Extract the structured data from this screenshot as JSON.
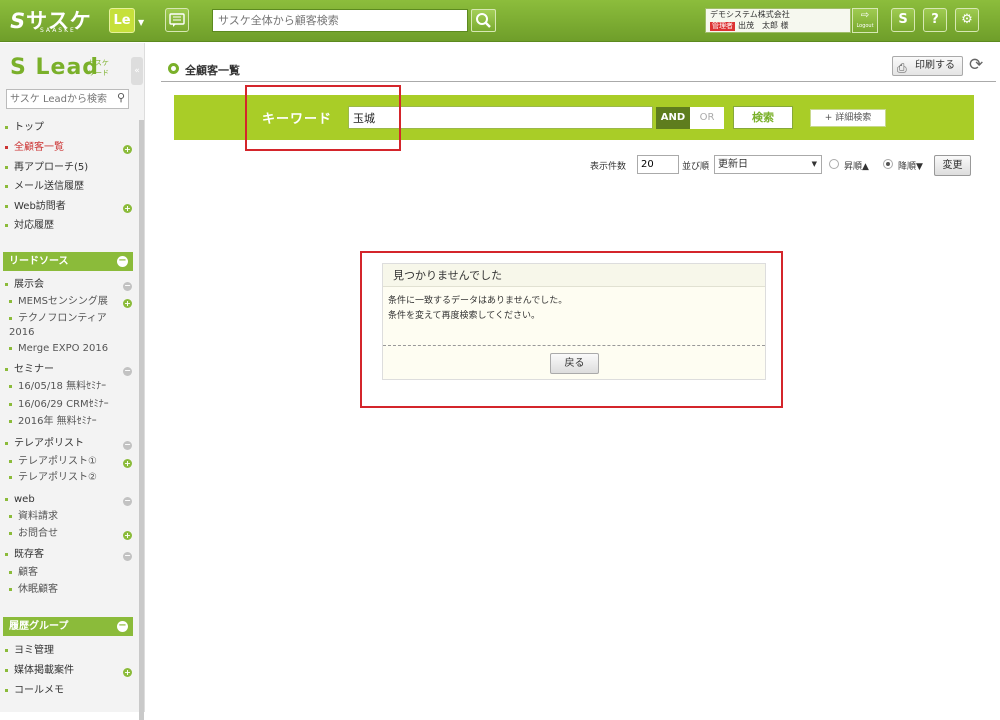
{
  "header": {
    "logo_text": "サスケ",
    "logo_sub": "SAASKE",
    "app_badge": "Le",
    "search_placeholder": "サスケ全体から顧客検索",
    "user_company": "デモシステム株式会社",
    "user_role": "管理者",
    "user_name": "出茂　太郎 様",
    "logout_label": "Logout",
    "help_label": "?"
  },
  "sidebar": {
    "logo": "Lead",
    "logo_sub_1": "サスケ",
    "logo_sub_2": "リード",
    "search_placeholder": "サスケ Leadから検索",
    "main_items": [
      {
        "label": "トップ"
      },
      {
        "label": "全顧客一覧"
      },
      {
        "label": "再アプローチ(5)"
      },
      {
        "label": "メール送信履歴"
      },
      {
        "label": "Web訪問者"
      },
      {
        "label": "対応履歴"
      }
    ],
    "lead_source_header": "リードソース",
    "lead_groups": [
      {
        "label": "展示会",
        "children": [
          "MEMSセンシング展",
          "テクノフロンティア2016",
          "Merge EXPO 2016"
        ]
      },
      {
        "label": "セミナー",
        "children": [
          "16/05/18 無料ｾﾐﾅｰ",
          "16/06/29 CRMｾﾐﾅｰ",
          "2016年 無料ｾﾐﾅｰ"
        ]
      },
      {
        "label": "テレアポリスト",
        "children": [
          "テレアポリスト①",
          "テレアポリスト②"
        ]
      },
      {
        "label": "web",
        "children": [
          "資料請求",
          "お問合せ"
        ]
      },
      {
        "label": "既存客",
        "children": [
          "顧客",
          "休眠顧客"
        ]
      }
    ],
    "history_group_header": "履歴グループ",
    "history_items": [
      {
        "label": "ヨミ管理"
      },
      {
        "label": "媒体掲載案件"
      },
      {
        "label": "コールメモ"
      }
    ]
  },
  "main": {
    "page_title": "全顧客一覧",
    "print_label": "印刷する",
    "keyword_label": "キーワード",
    "keyword_value": "玉城",
    "and_label": "AND",
    "or_label": "OR",
    "search_label": "検索",
    "advanced_label": "+ 詳細検索",
    "count_label": "表示件数",
    "count_value": "20",
    "sort_label": "並び順",
    "sort_value": "更新日",
    "asc_label": "昇順▲",
    "desc_label": "降順▼",
    "change_label": "変更",
    "notfound": {
      "title": "見つかりませんでした",
      "line1": "条件に一致するデータはありませんでした。",
      "line2": "条件を変えて再度検索してください。",
      "back_label": "戻る"
    }
  },
  "colors": {
    "brand_green": "#8cbd3c",
    "keyword_bar": "#a9cd27",
    "highlight_red": "#d4252b",
    "active_nav": "#cc3333"
  }
}
